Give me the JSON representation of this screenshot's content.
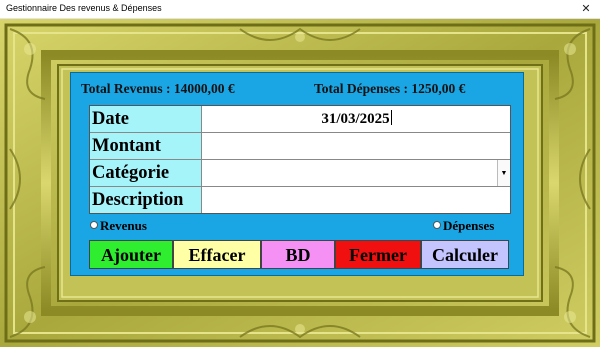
{
  "window": {
    "title": "Gestionnaire Des revenus & Dépenses",
    "close_glyph": "✕"
  },
  "colors": {
    "panel": "#1aa6e4",
    "label_bg": "#a5f4fa",
    "frame_gold": "#b9b84a",
    "btn_ajouter": "#2fee30",
    "btn_effacer": "#ffffa6",
    "btn_bd": "#f590f5",
    "btn_fermer": "#f01010",
    "btn_calculer": "#c4c4ff"
  },
  "totals": {
    "revenus": "Total Revenus : 14000,00 €",
    "depenses": "Total Dépenses : 1250,00 €"
  },
  "form": {
    "date_label": "Date",
    "date_value": "31/03/2025",
    "montant_label": "Montant",
    "montant_value": "",
    "categorie_label": "Catégorie",
    "categorie_value": "",
    "description_label": "Description",
    "description_value": ""
  },
  "radios": {
    "revenus": "Revenus",
    "depenses": "Dépenses"
  },
  "buttons": {
    "ajouter": "Ajouter",
    "effacer": "Effacer",
    "bd": "BD",
    "fermer": "Fermer",
    "calculer": "Calculer"
  },
  "icons": {
    "close": "close-icon",
    "dropdown": "chevron-down-icon"
  }
}
